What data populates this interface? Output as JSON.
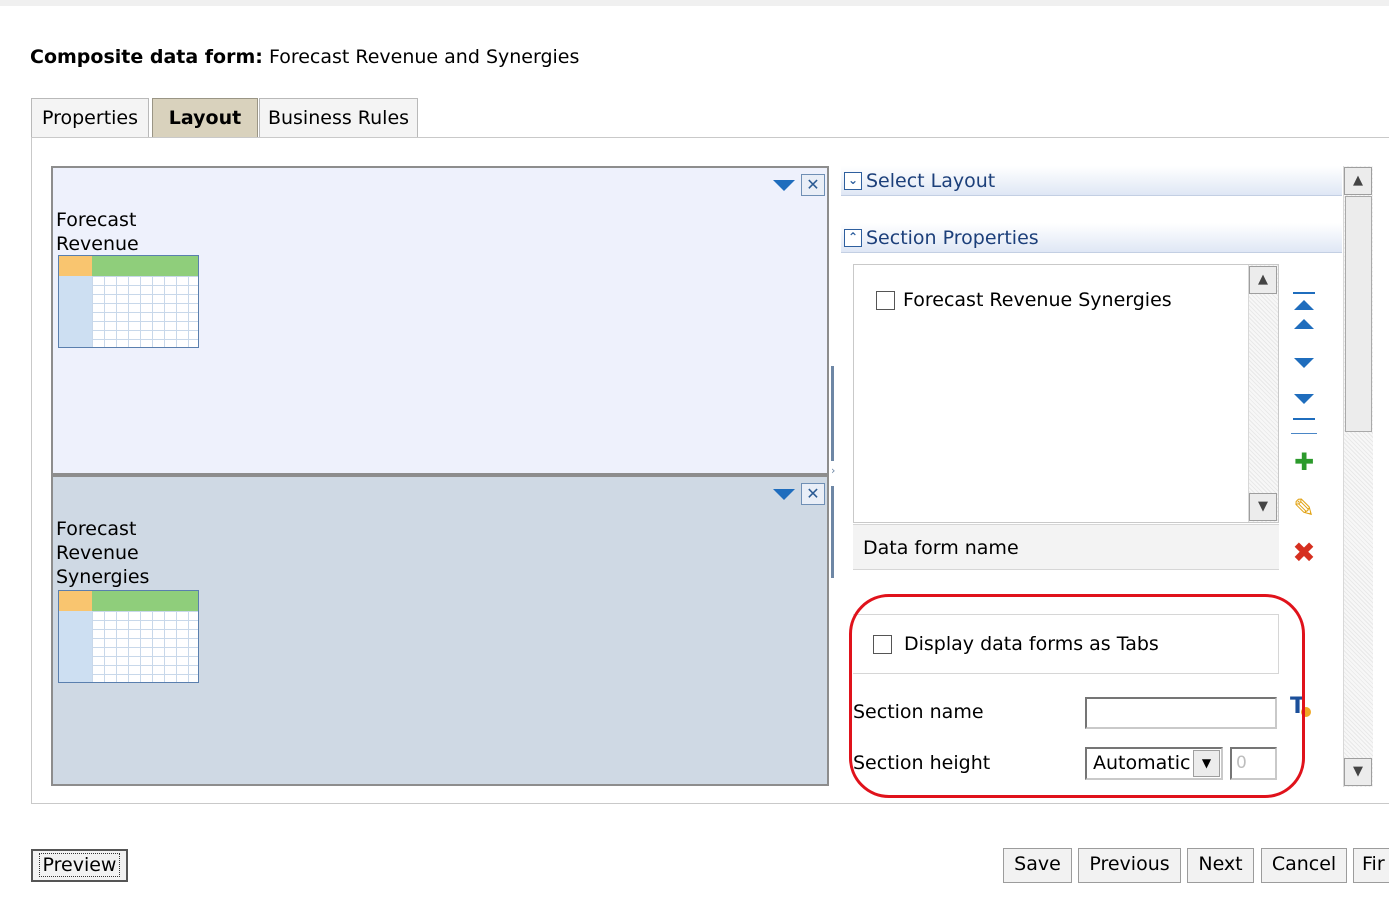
{
  "page": {
    "title_prefix": "Composite data form:",
    "title_value": "Forecast Revenue and Synergies"
  },
  "tabs": [
    {
      "label": "Properties",
      "active": false
    },
    {
      "label": "Layout",
      "active": true
    },
    {
      "label": "Business Rules",
      "active": false
    }
  ],
  "layout": {
    "sections": [
      {
        "form_label": "Forecast\nRevenue"
      },
      {
        "form_label": "Forecast\nRevenue\nSynergies"
      }
    ],
    "close_glyph": "✕"
  },
  "right_panel": {
    "select_layout_label": "Select Layout",
    "section_properties_label": "Section Properties",
    "forms_list": [
      {
        "label": "Forecast Revenue Synergies",
        "checked": false
      }
    ],
    "data_form_name_label": "Data form name",
    "display_tabs_label": "Display data forms as Tabs",
    "display_tabs_checked": false,
    "section_name_label": "Section name",
    "section_name_value": "",
    "section_height_label": "Section height",
    "section_height_selected": "Automatic",
    "section_height_value": "0"
  },
  "icons": {
    "move_top": "move-to-top-icon",
    "move_up": "move-up-icon",
    "move_down": "move-down-icon",
    "move_bottom": "move-to-bottom-icon",
    "add_form": "add-data-form-icon",
    "edit_form": "edit-pencil-icon",
    "delete_form": "delete-icon"
  },
  "footer": {
    "preview_label": "Preview",
    "save_label": "Save",
    "previous_label": "Previous",
    "next_label": "Next",
    "cancel_label": "Cancel",
    "finish_label": "Fir"
  },
  "colors": {
    "active_tab": "#d9d2bd",
    "section_top_bg": "#eef1fc",
    "section_bottom_bg": "#cfd9e4",
    "highlight": "#e0121b",
    "accent_blue": "#1f6dbd"
  }
}
